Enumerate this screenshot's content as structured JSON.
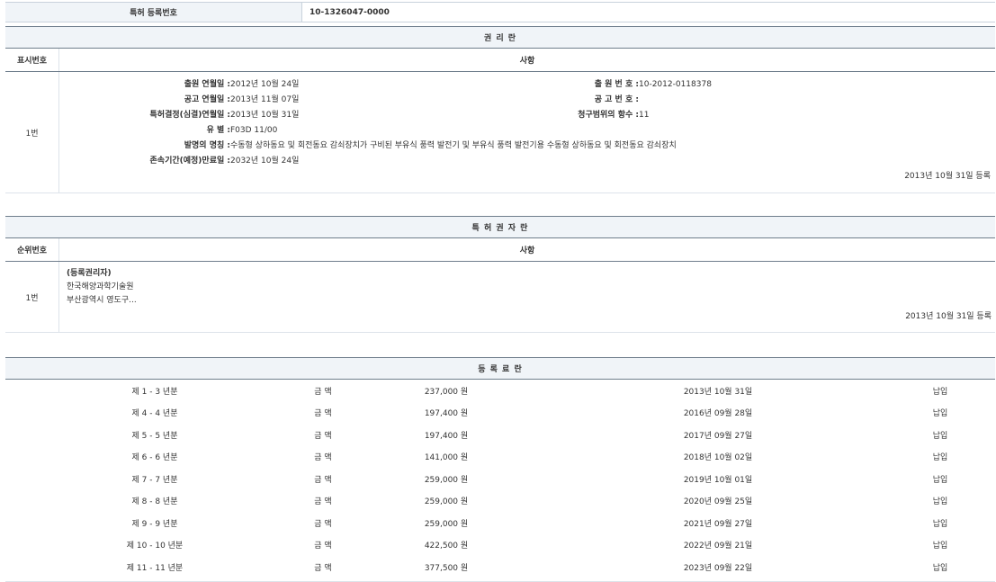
{
  "reg_number": {
    "label": "특허 등록번호",
    "value": "10-1326047-0000"
  },
  "rights_section": {
    "title": "권 리 란",
    "col_index": "표시번호",
    "col_content": "사항",
    "row_index": "1번",
    "left_fields": [
      {
        "key": "출원 연월일 :",
        "value": " 2012년 10월 24일"
      },
      {
        "key": "공고 연월일 :",
        "value": " 2013년 11월 07일"
      },
      {
        "key": "특허결정(심결)연월일 :",
        "value": " 2013년 10월 31일"
      },
      {
        "key": "유 별 :",
        "value": " F03D 11/00"
      },
      {
        "key": "발명의 명칭 :",
        "value": " 수동형 상하동요 및 회전동요 감쇠장치가 구비된 부유식 풍력 발전기 및 부유식 풍력 발전기용 수동형 상하동요 및 회전동요 감쇠장치"
      },
      {
        "key": "존속기간(예정)만료일 :",
        "value": " 2032년 10월 24일"
      }
    ],
    "right_fields": [
      {
        "key": "출 원 번 호 :",
        "value": " 10-2012-0118378"
      },
      {
        "key": "공 고 번 호 :",
        "value": ""
      },
      {
        "key": "청구범위의 항수 :",
        "value": " 11"
      }
    ],
    "registered": "2013년 10월 31일 등록"
  },
  "owner_section": {
    "title": "특 허 권 자 란",
    "col_index": "순위번호",
    "col_content": "사항",
    "row_index": "1번",
    "lines": [
      "(등록권리자)",
      "한국해양과학기술원",
      "부산광역시 영도구..."
    ],
    "registered": "2013년 10월 31일 등록"
  },
  "fee_section": {
    "title": "등 록 료 란",
    "rows": [
      {
        "period": "제 1 - 3 년분",
        "label": "금 액",
        "amount": "237,000 원",
        "date": "2013년 10월 31일",
        "status": "납입"
      },
      {
        "period": "제 4 - 4 년분",
        "label": "금 액",
        "amount": "197,400 원",
        "date": "2016년 09월 28일",
        "status": "납입"
      },
      {
        "period": "제 5 - 5 년분",
        "label": "금 액",
        "amount": "197,400 원",
        "date": "2017년 09월 27일",
        "status": "납입"
      },
      {
        "period": "제 6 - 6 년분",
        "label": "금 액",
        "amount": "141,000 원",
        "date": "2018년 10월 02일",
        "status": "납입"
      },
      {
        "period": "제 7 - 7 년분",
        "label": "금 액",
        "amount": "259,000 원",
        "date": "2019년 10월 01일",
        "status": "납입"
      },
      {
        "period": "제 8 - 8 년분",
        "label": "금 액",
        "amount": "259,000 원",
        "date": "2020년 09월 25일",
        "status": "납입"
      },
      {
        "period": "제 9 - 9 년분",
        "label": "금 액",
        "amount": "259,000 원",
        "date": "2021년 09월 27일",
        "status": "납입"
      },
      {
        "period": "제 10 - 10 년분",
        "label": "금 액",
        "amount": "422,500 원",
        "date": "2022년 09월 21일",
        "status": "납입"
      },
      {
        "period": "제 11 - 11 년분",
        "label": "금 액",
        "amount": "377,500 원",
        "date": "2023년 09월 22일",
        "status": "납입"
      }
    ]
  }
}
